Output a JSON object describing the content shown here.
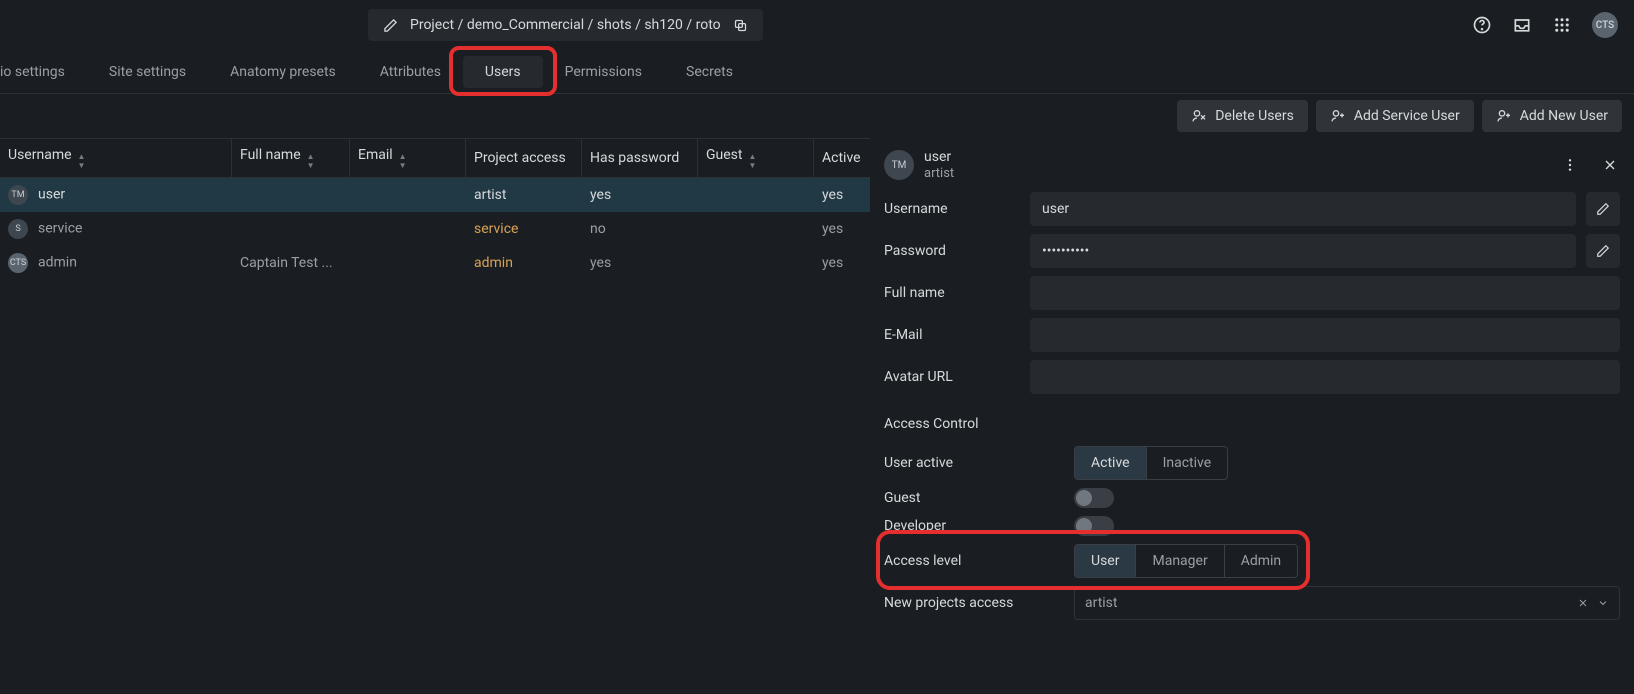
{
  "breadcrumb": "Project / demo_Commercial / shots / sh120 / roto",
  "avatar_initials": "CTS",
  "tabs": {
    "studio_settings": "io settings",
    "site_settings": "Site settings",
    "anatomy_presets": "Anatomy presets",
    "attributes": "Attributes",
    "users": "Users",
    "permissions": "Permissions",
    "secrets": "Secrets"
  },
  "actions": {
    "delete_users": "Delete Users",
    "add_service_user": "Add Service User",
    "add_new_user": "Add New User"
  },
  "columns": {
    "username": "Username",
    "full_name": "Full name",
    "email": "Email",
    "project_access": "Project access",
    "has_password": "Has password",
    "guest": "Guest",
    "active": "Active"
  },
  "rows": [
    {
      "av": "TM",
      "username": "user",
      "full_name": "",
      "project_access": "artist",
      "pa_style": "",
      "has_password": "yes",
      "active": "yes",
      "selected": true
    },
    {
      "av": "S",
      "username": "service",
      "full_name": "",
      "project_access": "service",
      "pa_style": "orange",
      "has_password": "no",
      "active": "yes",
      "selected": false
    },
    {
      "av": "CTS",
      "username": "admin",
      "full_name": "Captain Test ...",
      "project_access": "admin",
      "pa_style": "orange",
      "has_password": "yes",
      "active": "yes",
      "selected": false
    }
  ],
  "detail": {
    "header_av": "TM",
    "title": "user",
    "subtitle": "artist",
    "username_label": "Username",
    "username_value": "user",
    "password_label": "Password",
    "password_value": "••••••••••",
    "fullname_label": "Full name",
    "fullname_value": "",
    "email_label": "E-Mail",
    "email_value": "",
    "avatar_url_label": "Avatar URL",
    "avatar_url_value": "",
    "access_control": "Access Control",
    "user_active_label": "User active",
    "active_on": "Active",
    "inactive": "Inactive",
    "guest_label": "Guest",
    "developer_label": "Developer",
    "access_level_label": "Access level",
    "level_user": "User",
    "level_manager": "Manager",
    "level_admin": "Admin",
    "new_projects_access_label": "New projects access",
    "new_projects_access_value": "artist"
  }
}
